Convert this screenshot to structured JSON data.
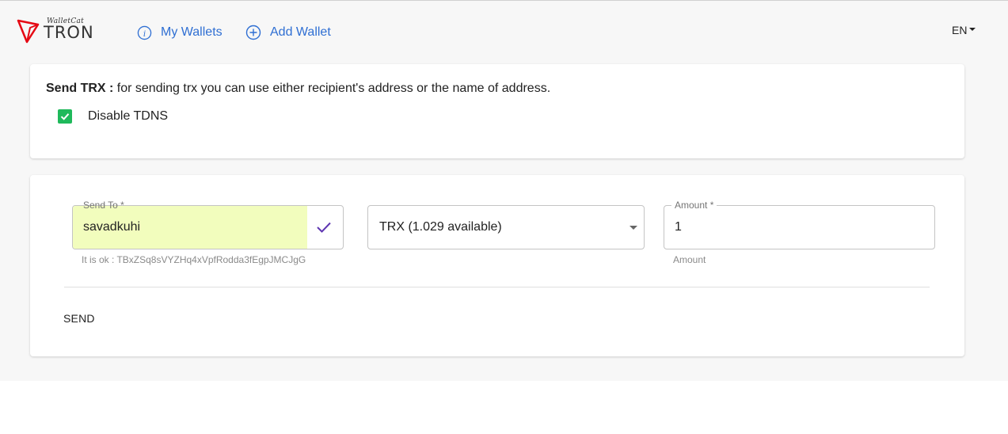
{
  "header": {
    "logo": {
      "script": "WalletCat",
      "word": "TRON"
    },
    "nav": [
      {
        "label": "My Wallets",
        "icon": "info-circle-icon"
      },
      {
        "label": "Add Wallet",
        "icon": "plus-circle-icon"
      }
    ],
    "language": "EN"
  },
  "intro": {
    "title": "Send TRX :",
    "text": " for sending trx you can use either recipient's address or the name of address.",
    "checkbox_label": "Disable TDNS",
    "checkbox_checked": true
  },
  "form": {
    "send_to": {
      "label": "Send To *",
      "value": "savadkuhi",
      "helper": "It is ok : TBxZSq8sVYZHq4xVpfRodda3fEgpJMCJgG"
    },
    "token": {
      "value": "TRX (1.029 available)"
    },
    "amount": {
      "label": "Amount *",
      "value": "1",
      "helper": "Amount"
    },
    "send_label": "SEND"
  },
  "colors": {
    "accent": "#2f6fd3",
    "check_green": "#1fb95b",
    "valid_fill": "#f2fdbd",
    "check_purple": "#5e35b1",
    "logo_red": "#e50914"
  }
}
